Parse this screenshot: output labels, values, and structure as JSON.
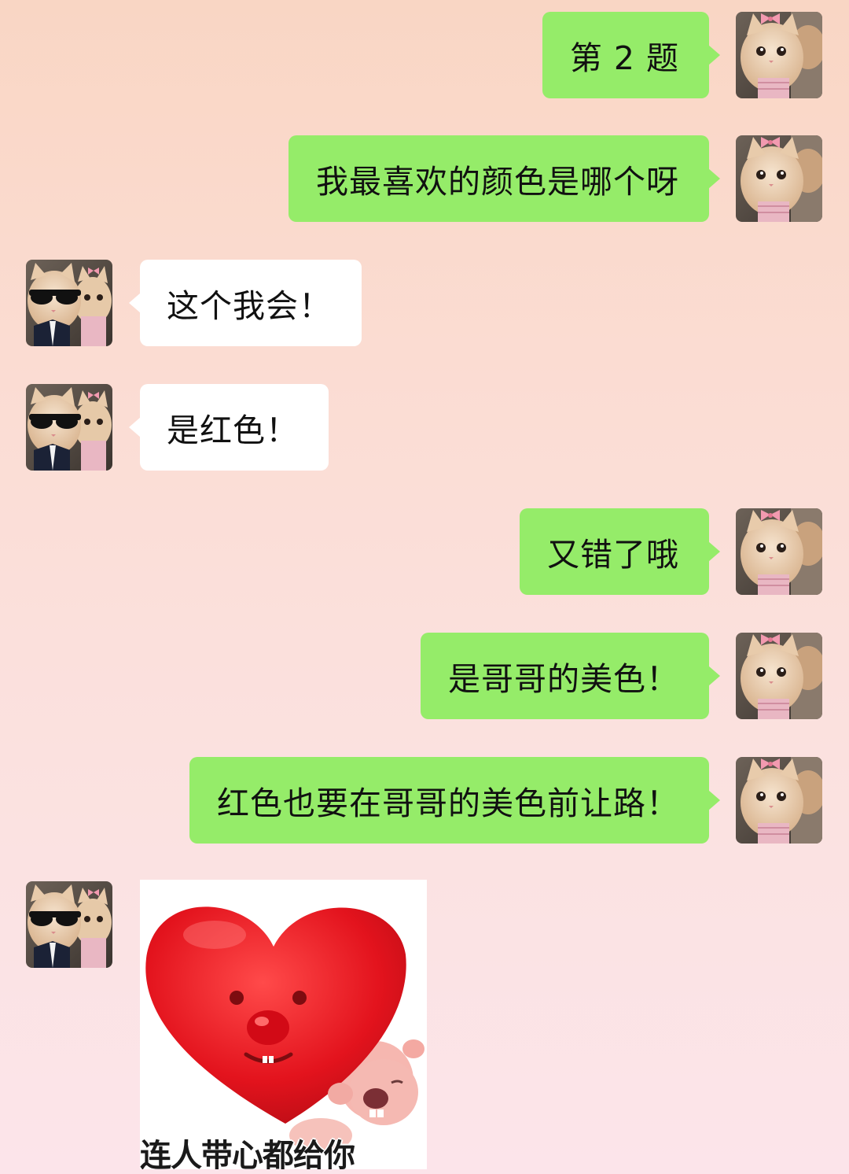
{
  "chat": {
    "messages": [
      {
        "side": "right",
        "text": "第 2 题"
      },
      {
        "side": "right",
        "text": "我最喜欢的颜色是哪个呀"
      },
      {
        "side": "left",
        "text": "这个我会！"
      },
      {
        "side": "left",
        "text": "是红色！"
      },
      {
        "side": "right",
        "text": "又错了哦"
      },
      {
        "side": "right",
        "text": "是哥哥的美色！"
      },
      {
        "side": "right",
        "text": "红色也要在哥哥的美色前让路！"
      }
    ],
    "sticker": {
      "caption": "连人带心都给你",
      "icon": "heart-beaver-sticker"
    }
  },
  "avatars": {
    "self": "cat-with-bow-avatar",
    "other": "cats-with-sunglasses-avatar"
  },
  "colors": {
    "self_bubble": "#95ec69",
    "other_bubble": "#ffffff",
    "heart": "#e3131d"
  }
}
